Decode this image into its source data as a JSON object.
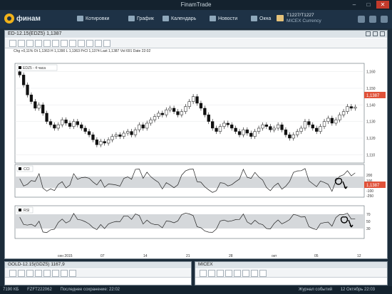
{
  "window": {
    "title": "FinamTrade"
  },
  "app": {
    "logo": "финам",
    "menu": [
      {
        "label": "Котировки",
        "icon": "quotes-icon"
      },
      {
        "label": "График",
        "icon": "chart-icon"
      },
      {
        "label": "Календарь",
        "icon": "calendar-icon"
      },
      {
        "label": "Новости",
        "icon": "news-icon"
      },
      {
        "label": "Окна",
        "icon": "windows-icon"
      }
    ],
    "account": {
      "line1": "T1227/T1227",
      "line2": "MICEX Currency"
    }
  },
  "main_panel": {
    "title": "ED-12.15(EDZ5) 1,1387",
    "info": "Chg +0,11%  Ot 1,1363  H 1,1390  L 1,1363  PrCl 1,1374  Last 1,1387  Vol 691  Date 22:02",
    "legend": "EDZ5 - 4 часа",
    "price_ticks": [
      "1,160",
      "1,150",
      "1,140",
      "1,130",
      "1,120",
      "1,110"
    ],
    "last_price": "1,1387",
    "dates": [
      "сен 2015",
      "07",
      "14",
      "21",
      "28",
      "окт",
      "05",
      "12"
    ],
    "indicators": [
      {
        "name": "CCI",
        "ticks": [
          "200",
          "100",
          "-100",
          "-250"
        ],
        "flag": "1,1387"
      },
      {
        "name": "RSI",
        "ticks": [
          "70",
          "50",
          "30"
        ],
        "flag": ""
      },
      {
        "name": "SO",
        "ticks": [
          "75",
          "50",
          "25"
        ],
        "flag": "1,1387"
      }
    ]
  },
  "lower_panels": [
    {
      "title": "GOLD-12.15(GDZ5) 1167,9"
    },
    {
      "title": "MICEX"
    }
  ],
  "status": {
    "memory": "7190 КБ",
    "id": "FZFT222062",
    "saved": "Последнее сохранение: 22:02",
    "journal": "Журнал событий",
    "datetime": "12 Октябрь 22:03"
  },
  "chart_data": {
    "type": "candlestick",
    "title": "EDZ5 - 4 часа",
    "ylim": [
      1.105,
      1.165
    ],
    "close": [
      1.158,
      1.152,
      1.146,
      1.142,
      1.138,
      1.14,
      1.135,
      1.13,
      1.128,
      1.126,
      1.128,
      1.131,
      1.129,
      1.127,
      1.13,
      1.128,
      1.126,
      1.124,
      1.122,
      1.119,
      1.116,
      1.118,
      1.117,
      1.119,
      1.121,
      1.122,
      1.121,
      1.123,
      1.124,
      1.122,
      1.125,
      1.128,
      1.126,
      1.129,
      1.131,
      1.133,
      1.135,
      1.134,
      1.137,
      1.138,
      1.136,
      1.134,
      1.136,
      1.139,
      1.142,
      1.145,
      1.141,
      1.138,
      1.134,
      1.13,
      1.126,
      1.124,
      1.127,
      1.129,
      1.128,
      1.126,
      1.124,
      1.122,
      1.125,
      1.123,
      1.121,
      1.124,
      1.126,
      1.128,
      1.127,
      1.125,
      1.126,
      1.128,
      1.125,
      1.122,
      1.12,
      1.122,
      1.124,
      1.126,
      1.13,
      1.128,
      1.126,
      1.124,
      1.127,
      1.13,
      1.132,
      1.129,
      1.131,
      1.134,
      1.136,
      1.139,
      1.138,
      1.1387
    ]
  }
}
